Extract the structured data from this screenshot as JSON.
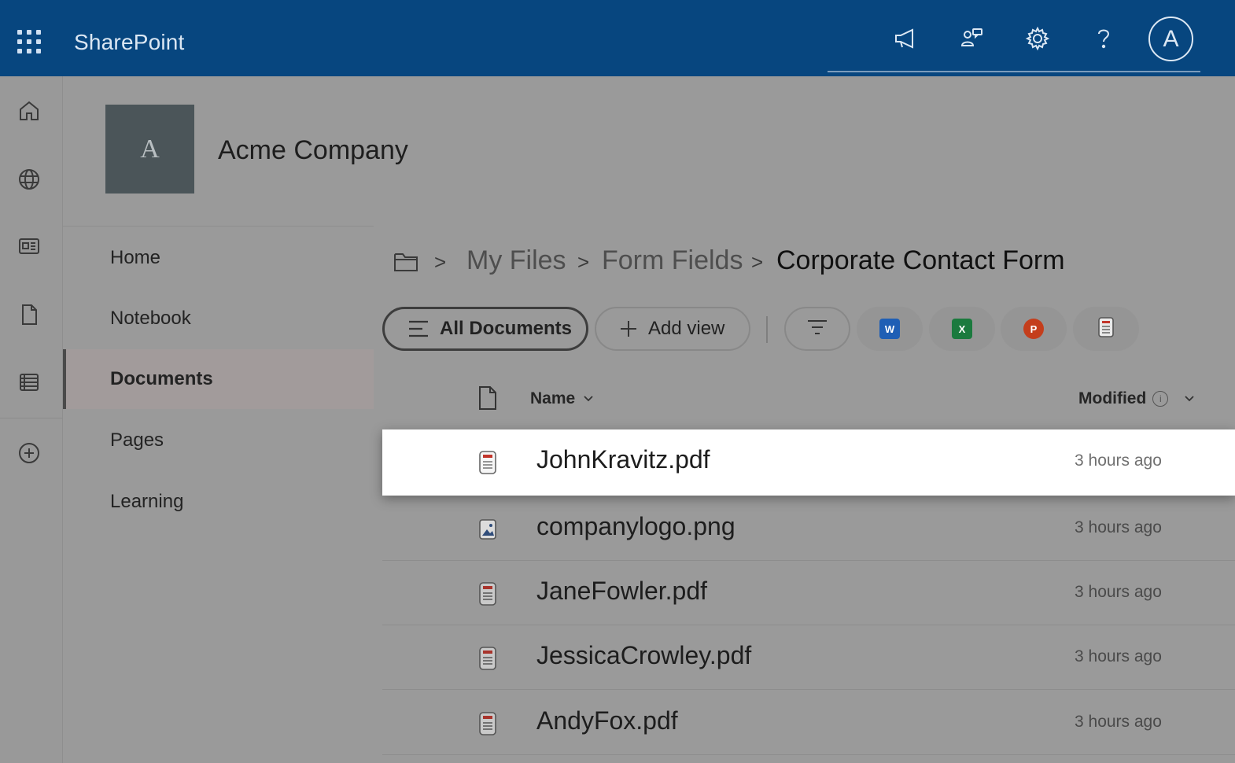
{
  "suite": {
    "brand": "SharePoint",
    "avatar_initial": "A"
  },
  "site": {
    "logo_initial": "A",
    "title": "Acme Company"
  },
  "nav": {
    "items": [
      {
        "label": "Home"
      },
      {
        "label": "Notebook"
      },
      {
        "label": "Documents",
        "selected": true
      },
      {
        "label": "Pages"
      },
      {
        "label": "Learning"
      }
    ]
  },
  "breadcrumb": {
    "items": [
      "My Files",
      "Form Fields",
      "Corporate Contact Form"
    ],
    "separator": ">"
  },
  "commandbar": {
    "all_documents": "All Documents",
    "add_view": "Add view"
  },
  "columns": {
    "name": "Name",
    "modified": "Modified"
  },
  "files": [
    {
      "name": "JohnKravitz.pdf",
      "modified": "3 hours ago",
      "type": "pdf",
      "highlight": true
    },
    {
      "name": "companylogo.png",
      "modified": "3 hours ago",
      "type": "image"
    },
    {
      "name": "JaneFowler.pdf",
      "modified": "3 hours ago",
      "type": "pdf"
    },
    {
      "name": "JessicaCrowley.pdf",
      "modified": "3 hours ago",
      "type": "pdf"
    },
    {
      "name": "AndyFox.pdf",
      "modified": "3 hours ago",
      "type": "pdf"
    }
  ],
  "colors": {
    "suite_bar": "#07467f",
    "word": "#1f5fb5",
    "excel": "#1b7a3e",
    "powerpoint": "#c43e1c",
    "pdf": "#c2352b"
  }
}
